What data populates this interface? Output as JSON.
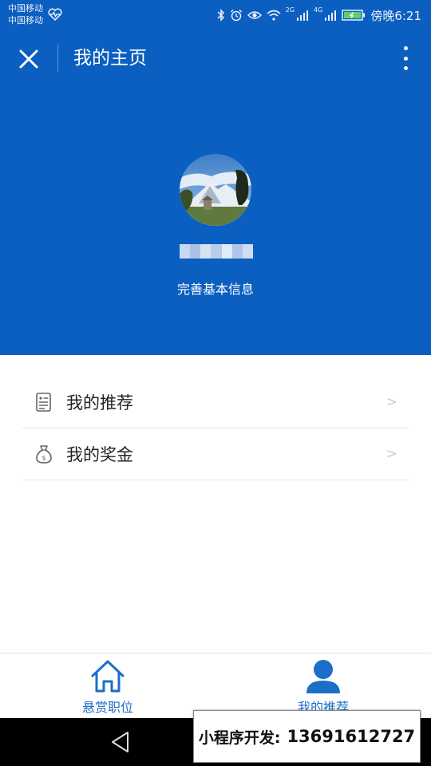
{
  "status_bar": {
    "carrier_1": "中国移动",
    "carrier_2": "中国移动",
    "net_2g": "2G",
    "net_4g": "4G",
    "time": "傍晚6:21",
    "icons": [
      "heart-rate-icon",
      "bluetooth-icon",
      "alarm-icon",
      "eye-icon",
      "wifi-icon",
      "signal-icon",
      "battery-charging-icon"
    ]
  },
  "header": {
    "title": "我的主页",
    "close_icon": "close-icon",
    "more_icon": "more-vertical-icon",
    "complete_info": "完善基本信息",
    "background": "#0b5fc0"
  },
  "menu": {
    "items": [
      {
        "label": "我的推荐",
        "icon": "document-icon",
        "arrow": ">"
      },
      {
        "label": "我的奖金",
        "icon": "money-bag-icon",
        "arrow": ">"
      }
    ]
  },
  "tabbar": {
    "tabs": [
      {
        "label": "悬赏职位",
        "icon": "home-icon",
        "active": false
      },
      {
        "label": "我的推荐",
        "icon": "user-icon",
        "active": true
      }
    ],
    "accent": "#1a6fc9"
  },
  "system_nav": {
    "icon": "back-triangle-icon"
  },
  "promo": {
    "text": "小程序开发:",
    "phone": "13691612727"
  }
}
